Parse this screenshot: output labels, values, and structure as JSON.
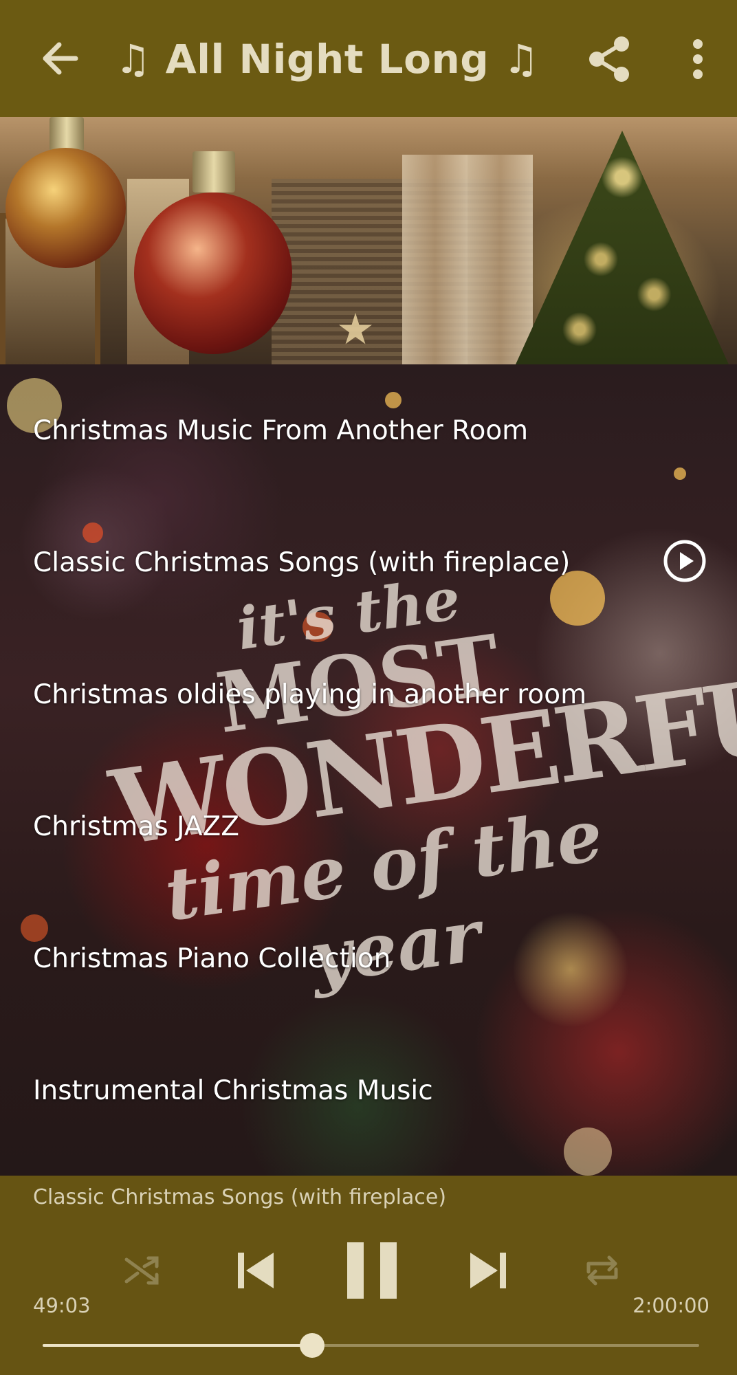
{
  "appbar": {
    "title": "♫ All Night Long ♫"
  },
  "playlist": [
    {
      "label": "Christmas Music From Another Room"
    },
    {
      "label": "Classic Christmas Songs (with fireplace)",
      "playing": true
    },
    {
      "label": "Christmas oldies playing in another room"
    },
    {
      "label": "Christmas JAZZ"
    },
    {
      "label": "Christmas Piano Collection"
    },
    {
      "label": "Instrumental Christmas Music"
    }
  ],
  "background_lettering": {
    "line1": "it's the",
    "line2": "MOST",
    "line3": "WONDERFUL",
    "line4": "time of the year"
  },
  "player": {
    "now_playing": "Classic Christmas Songs (with fireplace)",
    "elapsed": "49:03",
    "duration": "2:00:00",
    "progress": 0.41,
    "state": "playing"
  },
  "colors": {
    "appbar": "#6b5a12",
    "accent": "#ece3c6"
  }
}
